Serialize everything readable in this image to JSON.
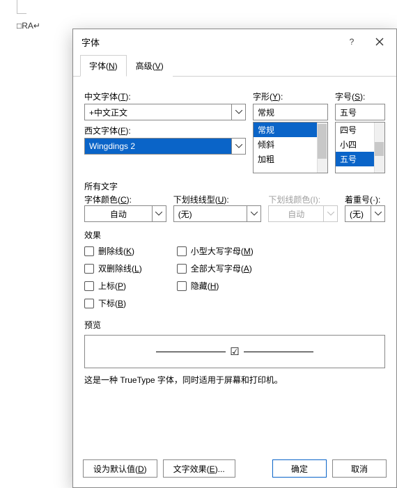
{
  "doc_text": "□RA↵",
  "dialog": {
    "title": "字体",
    "help_tip": "?",
    "close_tip": "✕"
  },
  "tabs": {
    "font": "字体(N)",
    "advanced": "高级(V)"
  },
  "labels": {
    "cjk_font": "中文字体(T):",
    "latin_font": "西文字体(F):",
    "style": "字形(Y):",
    "size": "字号(S):",
    "all_text": "所有文字",
    "font_color": "字体颜色(C):",
    "underline_style": "下划线线型(U):",
    "underline_color": "下划线颜色(I):",
    "emphasis": "着重号(·):",
    "effects": "效果",
    "preview": "预览"
  },
  "values": {
    "cjk_font": "+中文正文",
    "latin_font": "Wingdings 2",
    "style": "常规",
    "size": "五号",
    "font_color": "自动",
    "underline_style": "(无)",
    "underline_color": "自动",
    "emphasis": "(无)"
  },
  "style_options": [
    "常规",
    "倾斜",
    "加粗"
  ],
  "size_options": [
    "四号",
    "小四",
    "五号"
  ],
  "effects_left": [
    {
      "label": "删除线(K)"
    },
    {
      "label": "双删除线(L)"
    },
    {
      "label": "上标(P)"
    },
    {
      "label": "下标(B)"
    }
  ],
  "effects_right": [
    {
      "label": "小型大写字母(M)"
    },
    {
      "label": "全部大写字母(A)"
    },
    {
      "label": "隐藏(H)"
    }
  ],
  "preview_glyph": "☑",
  "note": "这是一种 TrueType 字体，同时适用于屏幕和打印机。",
  "buttons": {
    "set_default": "设为默认值(D)",
    "text_effects": "文字效果(E)...",
    "ok": "确定",
    "cancel": "取消"
  }
}
